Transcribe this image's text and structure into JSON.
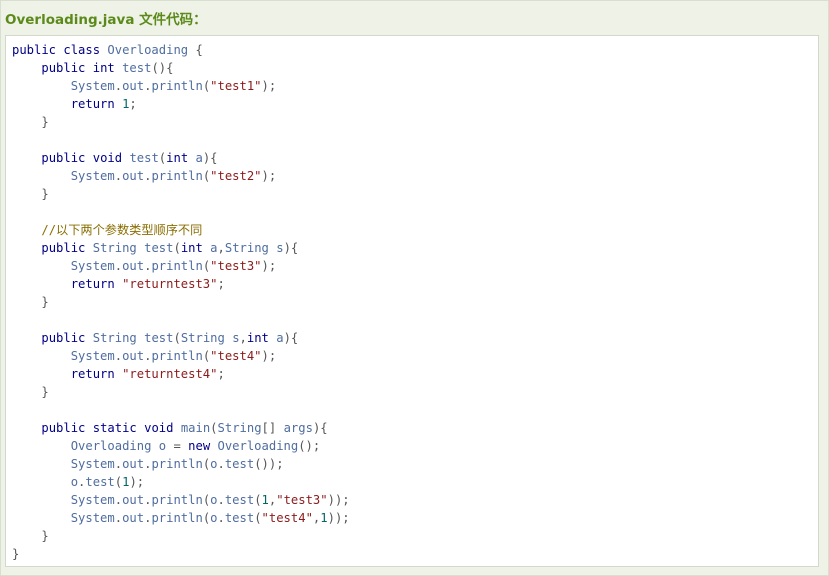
{
  "caption": "Overloading.java 文件代码：",
  "code_lines": [
    [
      {
        "t": "kw",
        "v": "public"
      },
      {
        "t": "pl",
        "v": " "
      },
      {
        "t": "kw",
        "v": "class"
      },
      {
        "t": "pl",
        "v": " "
      },
      {
        "t": "id",
        "v": "Overloading"
      },
      {
        "t": "pl",
        "v": " "
      },
      {
        "t": "pun",
        "v": "{"
      }
    ],
    [
      {
        "t": "pl",
        "v": "    "
      },
      {
        "t": "kw",
        "v": "public"
      },
      {
        "t": "pl",
        "v": " "
      },
      {
        "t": "kw",
        "v": "int"
      },
      {
        "t": "pl",
        "v": " "
      },
      {
        "t": "id",
        "v": "test"
      },
      {
        "t": "pun",
        "v": "(){"
      }
    ],
    [
      {
        "t": "pl",
        "v": "        "
      },
      {
        "t": "id",
        "v": "System"
      },
      {
        "t": "pun",
        "v": "."
      },
      {
        "t": "id",
        "v": "out"
      },
      {
        "t": "pun",
        "v": "."
      },
      {
        "t": "id",
        "v": "println"
      },
      {
        "t": "pun",
        "v": "("
      },
      {
        "t": "str",
        "v": "\"test1\""
      },
      {
        "t": "pun",
        "v": ");"
      }
    ],
    [
      {
        "t": "pl",
        "v": "        "
      },
      {
        "t": "kw",
        "v": "return"
      },
      {
        "t": "pl",
        "v": " "
      },
      {
        "t": "num",
        "v": "1"
      },
      {
        "t": "pun",
        "v": ";"
      }
    ],
    [
      {
        "t": "pl",
        "v": "    "
      },
      {
        "t": "pun",
        "v": "}"
      }
    ],
    [],
    [
      {
        "t": "pl",
        "v": "    "
      },
      {
        "t": "kw",
        "v": "public"
      },
      {
        "t": "pl",
        "v": " "
      },
      {
        "t": "kw",
        "v": "void"
      },
      {
        "t": "pl",
        "v": " "
      },
      {
        "t": "id",
        "v": "test"
      },
      {
        "t": "pun",
        "v": "("
      },
      {
        "t": "kw",
        "v": "int"
      },
      {
        "t": "pl",
        "v": " "
      },
      {
        "t": "id",
        "v": "a"
      },
      {
        "t": "pun",
        "v": "){"
      }
    ],
    [
      {
        "t": "pl",
        "v": "        "
      },
      {
        "t": "id",
        "v": "System"
      },
      {
        "t": "pun",
        "v": "."
      },
      {
        "t": "id",
        "v": "out"
      },
      {
        "t": "pun",
        "v": "."
      },
      {
        "t": "id",
        "v": "println"
      },
      {
        "t": "pun",
        "v": "("
      },
      {
        "t": "str",
        "v": "\"test2\""
      },
      {
        "t": "pun",
        "v": ");"
      }
    ],
    [
      {
        "t": "pl",
        "v": "    "
      },
      {
        "t": "pun",
        "v": "}"
      }
    ],
    [],
    [
      {
        "t": "pl",
        "v": "    "
      },
      {
        "t": "cm",
        "v": "//以下两个参数类型顺序不同"
      }
    ],
    [
      {
        "t": "pl",
        "v": "    "
      },
      {
        "t": "kw",
        "v": "public"
      },
      {
        "t": "pl",
        "v": " "
      },
      {
        "t": "id",
        "v": "String"
      },
      {
        "t": "pl",
        "v": " "
      },
      {
        "t": "id",
        "v": "test"
      },
      {
        "t": "pun",
        "v": "("
      },
      {
        "t": "kw",
        "v": "int"
      },
      {
        "t": "pl",
        "v": " "
      },
      {
        "t": "id",
        "v": "a"
      },
      {
        "t": "pun",
        "v": ","
      },
      {
        "t": "id",
        "v": "String"
      },
      {
        "t": "pl",
        "v": " "
      },
      {
        "t": "id",
        "v": "s"
      },
      {
        "t": "pun",
        "v": "){"
      }
    ],
    [
      {
        "t": "pl",
        "v": "        "
      },
      {
        "t": "id",
        "v": "System"
      },
      {
        "t": "pun",
        "v": "."
      },
      {
        "t": "id",
        "v": "out"
      },
      {
        "t": "pun",
        "v": "."
      },
      {
        "t": "id",
        "v": "println"
      },
      {
        "t": "pun",
        "v": "("
      },
      {
        "t": "str",
        "v": "\"test3\""
      },
      {
        "t": "pun",
        "v": ");"
      }
    ],
    [
      {
        "t": "pl",
        "v": "        "
      },
      {
        "t": "kw",
        "v": "return"
      },
      {
        "t": "pl",
        "v": " "
      },
      {
        "t": "str",
        "v": "\"returntest3\""
      },
      {
        "t": "pun",
        "v": ";"
      }
    ],
    [
      {
        "t": "pl",
        "v": "    "
      },
      {
        "t": "pun",
        "v": "}"
      }
    ],
    [],
    [
      {
        "t": "pl",
        "v": "    "
      },
      {
        "t": "kw",
        "v": "public"
      },
      {
        "t": "pl",
        "v": " "
      },
      {
        "t": "id",
        "v": "String"
      },
      {
        "t": "pl",
        "v": " "
      },
      {
        "t": "id",
        "v": "test"
      },
      {
        "t": "pun",
        "v": "("
      },
      {
        "t": "id",
        "v": "String"
      },
      {
        "t": "pl",
        "v": " "
      },
      {
        "t": "id",
        "v": "s"
      },
      {
        "t": "pun",
        "v": ","
      },
      {
        "t": "kw",
        "v": "int"
      },
      {
        "t": "pl",
        "v": " "
      },
      {
        "t": "id",
        "v": "a"
      },
      {
        "t": "pun",
        "v": "){"
      }
    ],
    [
      {
        "t": "pl",
        "v": "        "
      },
      {
        "t": "id",
        "v": "System"
      },
      {
        "t": "pun",
        "v": "."
      },
      {
        "t": "id",
        "v": "out"
      },
      {
        "t": "pun",
        "v": "."
      },
      {
        "t": "id",
        "v": "println"
      },
      {
        "t": "pun",
        "v": "("
      },
      {
        "t": "str",
        "v": "\"test4\""
      },
      {
        "t": "pun",
        "v": ");"
      }
    ],
    [
      {
        "t": "pl",
        "v": "        "
      },
      {
        "t": "kw",
        "v": "return"
      },
      {
        "t": "pl",
        "v": " "
      },
      {
        "t": "str",
        "v": "\"returntest4\""
      },
      {
        "t": "pun",
        "v": ";"
      }
    ],
    [
      {
        "t": "pl",
        "v": "    "
      },
      {
        "t": "pun",
        "v": "}"
      }
    ],
    [],
    [
      {
        "t": "pl",
        "v": "    "
      },
      {
        "t": "kw",
        "v": "public"
      },
      {
        "t": "pl",
        "v": " "
      },
      {
        "t": "kw",
        "v": "static"
      },
      {
        "t": "pl",
        "v": " "
      },
      {
        "t": "kw",
        "v": "void"
      },
      {
        "t": "pl",
        "v": " "
      },
      {
        "t": "id",
        "v": "main"
      },
      {
        "t": "pun",
        "v": "("
      },
      {
        "t": "id",
        "v": "String"
      },
      {
        "t": "pun",
        "v": "[]"
      },
      {
        "t": "pl",
        "v": " "
      },
      {
        "t": "id",
        "v": "args"
      },
      {
        "t": "pun",
        "v": "){"
      }
    ],
    [
      {
        "t": "pl",
        "v": "        "
      },
      {
        "t": "id",
        "v": "Overloading"
      },
      {
        "t": "pl",
        "v": " "
      },
      {
        "t": "id",
        "v": "o"
      },
      {
        "t": "pl",
        "v": " "
      },
      {
        "t": "pun",
        "v": "="
      },
      {
        "t": "pl",
        "v": " "
      },
      {
        "t": "kw",
        "v": "new"
      },
      {
        "t": "pl",
        "v": " "
      },
      {
        "t": "id",
        "v": "Overloading"
      },
      {
        "t": "pun",
        "v": "();"
      }
    ],
    [
      {
        "t": "pl",
        "v": "        "
      },
      {
        "t": "id",
        "v": "System"
      },
      {
        "t": "pun",
        "v": "."
      },
      {
        "t": "id",
        "v": "out"
      },
      {
        "t": "pun",
        "v": "."
      },
      {
        "t": "id",
        "v": "println"
      },
      {
        "t": "pun",
        "v": "("
      },
      {
        "t": "id",
        "v": "o"
      },
      {
        "t": "pun",
        "v": "."
      },
      {
        "t": "id",
        "v": "test"
      },
      {
        "t": "pun",
        "v": "());"
      }
    ],
    [
      {
        "t": "pl",
        "v": "        "
      },
      {
        "t": "id",
        "v": "o"
      },
      {
        "t": "pun",
        "v": "."
      },
      {
        "t": "id",
        "v": "test"
      },
      {
        "t": "pun",
        "v": "("
      },
      {
        "t": "num",
        "v": "1"
      },
      {
        "t": "pun",
        "v": ");"
      }
    ],
    [
      {
        "t": "pl",
        "v": "        "
      },
      {
        "t": "id",
        "v": "System"
      },
      {
        "t": "pun",
        "v": "."
      },
      {
        "t": "id",
        "v": "out"
      },
      {
        "t": "pun",
        "v": "."
      },
      {
        "t": "id",
        "v": "println"
      },
      {
        "t": "pun",
        "v": "("
      },
      {
        "t": "id",
        "v": "o"
      },
      {
        "t": "pun",
        "v": "."
      },
      {
        "t": "id",
        "v": "test"
      },
      {
        "t": "pun",
        "v": "("
      },
      {
        "t": "num",
        "v": "1"
      },
      {
        "t": "pun",
        "v": ","
      },
      {
        "t": "str",
        "v": "\"test3\""
      },
      {
        "t": "pun",
        "v": "));"
      }
    ],
    [
      {
        "t": "pl",
        "v": "        "
      },
      {
        "t": "id",
        "v": "System"
      },
      {
        "t": "pun",
        "v": "."
      },
      {
        "t": "id",
        "v": "out"
      },
      {
        "t": "pun",
        "v": "."
      },
      {
        "t": "id",
        "v": "println"
      },
      {
        "t": "pun",
        "v": "("
      },
      {
        "t": "id",
        "v": "o"
      },
      {
        "t": "pun",
        "v": "."
      },
      {
        "t": "id",
        "v": "test"
      },
      {
        "t": "pun",
        "v": "("
      },
      {
        "t": "str",
        "v": "\"test4\""
      },
      {
        "t": "pun",
        "v": ","
      },
      {
        "t": "num",
        "v": "1"
      },
      {
        "t": "pun",
        "v": "));"
      }
    ],
    [
      {
        "t": "pl",
        "v": "    "
      },
      {
        "t": "pun",
        "v": "}"
      }
    ],
    [
      {
        "t": "pun",
        "v": "}"
      }
    ]
  ]
}
